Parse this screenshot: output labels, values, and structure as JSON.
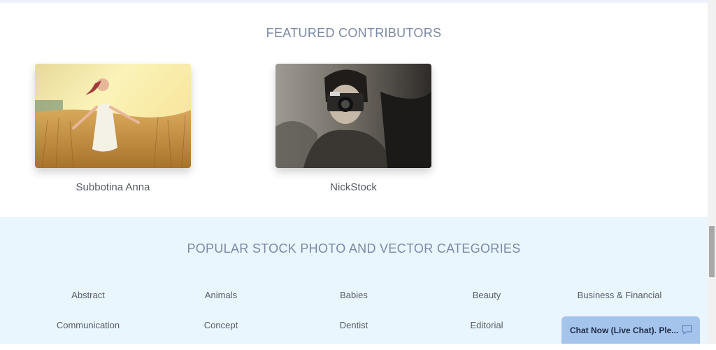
{
  "featured": {
    "title": "FEATURED CONTRIBUTORS",
    "contributors": [
      {
        "name": "Subbotina Anna",
        "photo_icon": "woman-in-wheat-field-photo"
      },
      {
        "name": "NickStock",
        "photo_icon": "man-with-camera-photo"
      }
    ]
  },
  "categories": {
    "title": "POPULAR STOCK PHOTO AND VECTOR CATEGORIES",
    "rows": [
      [
        "Abstract",
        "Animals",
        "Babies",
        "Beauty",
        "Business & Financial"
      ],
      [
        "Communication",
        "Concept",
        "Dentist",
        "Editorial",
        ""
      ]
    ]
  },
  "chat": {
    "label": "Chat Now (Live Chat). Ple...",
    "icon": "chat-bubble-icon"
  },
  "colors": {
    "section_title": "#7a89a6",
    "categories_bg": "#eaf6fd",
    "chat_bg": "#a5c4ec"
  }
}
